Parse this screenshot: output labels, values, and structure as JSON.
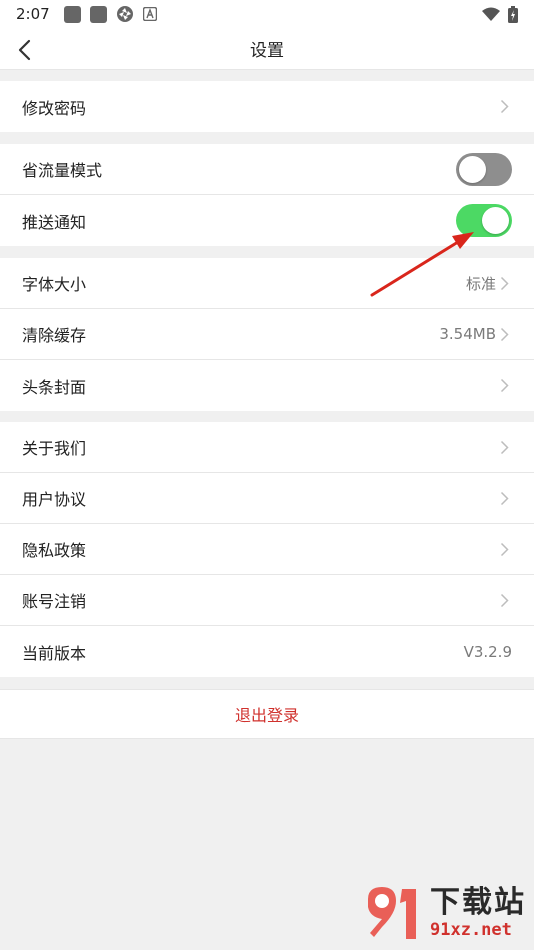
{
  "status_bar": {
    "time": "2:07"
  },
  "header": {
    "title": "设置"
  },
  "sections": [
    {
      "rows": [
        {
          "label": "修改密码",
          "kind": "chevron"
        }
      ]
    },
    {
      "rows": [
        {
          "label": "省流量模式",
          "kind": "toggle",
          "on": false
        },
        {
          "label": "推送通知",
          "kind": "toggle",
          "on": true
        }
      ]
    },
    {
      "rows": [
        {
          "label": "字体大小",
          "kind": "chevron",
          "value": "标准"
        },
        {
          "label": "清除缓存",
          "kind": "chevron",
          "value": "3.54MB"
        },
        {
          "label": "头条封面",
          "kind": "chevron"
        }
      ]
    },
    {
      "rows": [
        {
          "label": "关于我们",
          "kind": "chevron"
        },
        {
          "label": "用户协议",
          "kind": "chevron"
        },
        {
          "label": "隐私政策",
          "kind": "chevron"
        },
        {
          "label": "账号注销",
          "kind": "chevron"
        },
        {
          "label": "当前版本",
          "kind": "text",
          "value": "V3.2.9"
        }
      ]
    }
  ],
  "logout": {
    "label": "退出登录"
  },
  "watermark": {
    "big": "下载站",
    "url": "91xz.net"
  },
  "colors": {
    "toggle_on": "#4cd964",
    "toggle_off": "#8e8e8e",
    "logout": "#d0312d",
    "arrow": "#d9261c"
  }
}
